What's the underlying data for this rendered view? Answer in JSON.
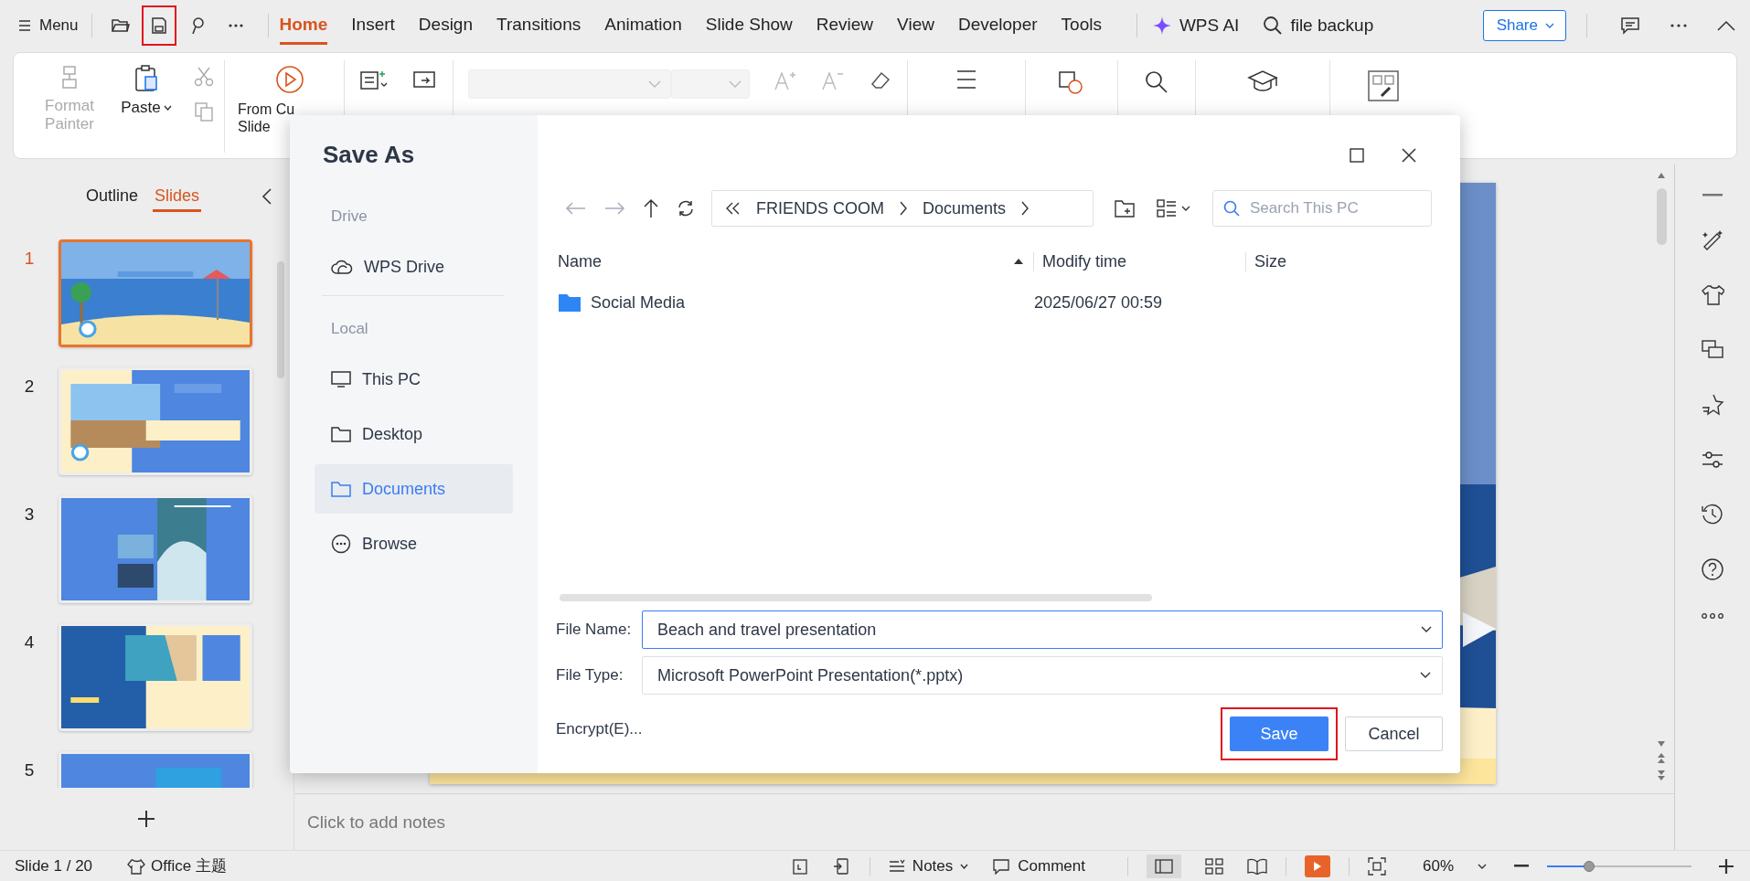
{
  "menu_bar": {
    "menu": "Menu",
    "quick_access": [
      {
        "kind": "open",
        "highlighted": false
      },
      {
        "kind": "save",
        "highlighted": true
      },
      {
        "kind": "format",
        "highlighted": false
      },
      {
        "kind": "more",
        "highlighted": false
      }
    ],
    "tabs": [
      {
        "label": "Home",
        "selected": true
      },
      {
        "label": "Insert",
        "selected": false
      },
      {
        "label": "Design",
        "selected": false
      },
      {
        "label": "Transitions",
        "selected": false
      },
      {
        "label": "Animation",
        "selected": false
      },
      {
        "label": "Slide Show",
        "selected": false
      },
      {
        "label": "Review",
        "selected": false
      },
      {
        "label": "View",
        "selected": false
      },
      {
        "label": "Developer",
        "selected": false
      },
      {
        "label": "Tools",
        "selected": false
      }
    ],
    "ai": "WPS AI",
    "search": "file backup",
    "share": "Share"
  },
  "ribbon": {
    "format_painter": {
      "label": "Format Painter",
      "disabled": true
    },
    "paste": "Paste",
    "from_current": [
      "From Cu",
      "Slide"
    ]
  },
  "slide_panel": {
    "tabs": [
      {
        "label": "Outline",
        "selected": false
      },
      {
        "label": "Slides",
        "selected": true
      }
    ],
    "slides": [
      {
        "number": "1",
        "selected": true,
        "kind": "picture"
      },
      {
        "number": "2",
        "selected": false,
        "kind": "picture"
      },
      {
        "number": "3",
        "selected": false,
        "kind": "picture"
      },
      {
        "number": "4",
        "selected": false,
        "kind": "picture"
      },
      {
        "number": "5",
        "selected": false,
        "kind": "picture"
      }
    ]
  },
  "notes": {
    "placeholder": "Click to add notes"
  },
  "status_bar": {
    "slide": "Slide 1 / 20",
    "theme": "Office 主题",
    "notes": "Notes",
    "comment": "Comment",
    "zoom": {
      "text": "60%",
      "level": 0.29
    }
  },
  "dialog": {
    "title": "Save As",
    "sections": [
      {
        "heading": "Drive",
        "items": [
          {
            "label": "WPS Drive",
            "kind": "cloud",
            "selected": false
          }
        ]
      },
      {
        "heading": "Local",
        "items": [
          {
            "label": "This PC",
            "kind": "monitor",
            "selected": false
          },
          {
            "label": "Desktop",
            "kind": "folder",
            "selected": false
          },
          {
            "label": "Documents",
            "kind": "folder",
            "selected": true
          },
          {
            "label": "Browse",
            "kind": "more",
            "selected": false
          }
        ]
      }
    ],
    "breadcrumb": [
      "FRIENDS COOM",
      "Documents"
    ],
    "search": {
      "placeholder": "Search This PC"
    },
    "columns": [
      "Name",
      "Modify time",
      "Size"
    ],
    "files": [
      {
        "name": "Social Media",
        "modified": "2025/06/27 00:59",
        "kind": "folder"
      }
    ],
    "file_name_label": "File Name:",
    "file_name": "Beach and travel presentation",
    "file_type_label": "File Type:",
    "file_type": "Microsoft PowerPoint Presentation(*.pptx)",
    "encrypt": "Encrypt(E)...",
    "save": {
      "label": "Save",
      "highlighted": true
    },
    "cancel": "Cancel"
  }
}
